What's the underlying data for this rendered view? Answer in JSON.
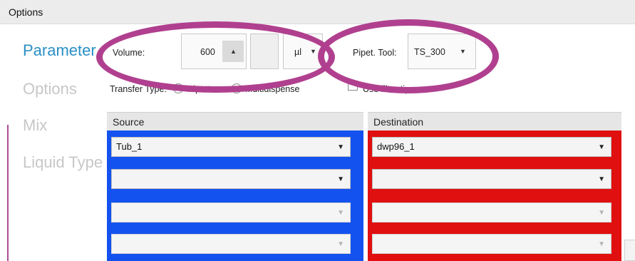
{
  "header": {
    "title": "Options"
  },
  "nav": {
    "items": [
      {
        "label": "Parameter",
        "active": true
      },
      {
        "label": "Options",
        "active": false
      },
      {
        "label": "Mix",
        "active": false
      },
      {
        "label": "Liquid Type",
        "active": false
      }
    ]
  },
  "volume": {
    "label": "Volume:",
    "value": "600",
    "unit": "µl"
  },
  "pipet_tool": {
    "label": "Pipet. Tool:",
    "value": "TS_300"
  },
  "transfer_type": {
    "label": "Transfer Type:",
    "options": [
      "Pipette",
      "Multidispense"
    ],
    "selected": "Multidispense"
  },
  "filter_tips": {
    "label": "Use filter tips",
    "checked": false
  },
  "source": {
    "title": "Source",
    "color": "#1452f0",
    "dropdowns": [
      "Tub_1",
      "",
      "",
      ""
    ]
  },
  "destination": {
    "title": "Destination",
    "color": "#e01010",
    "dropdowns": [
      "dwp96_1",
      "",
      "",
      ""
    ]
  },
  "annotation_color": "#b0408f",
  "accent_color": "#2a8fc6"
}
